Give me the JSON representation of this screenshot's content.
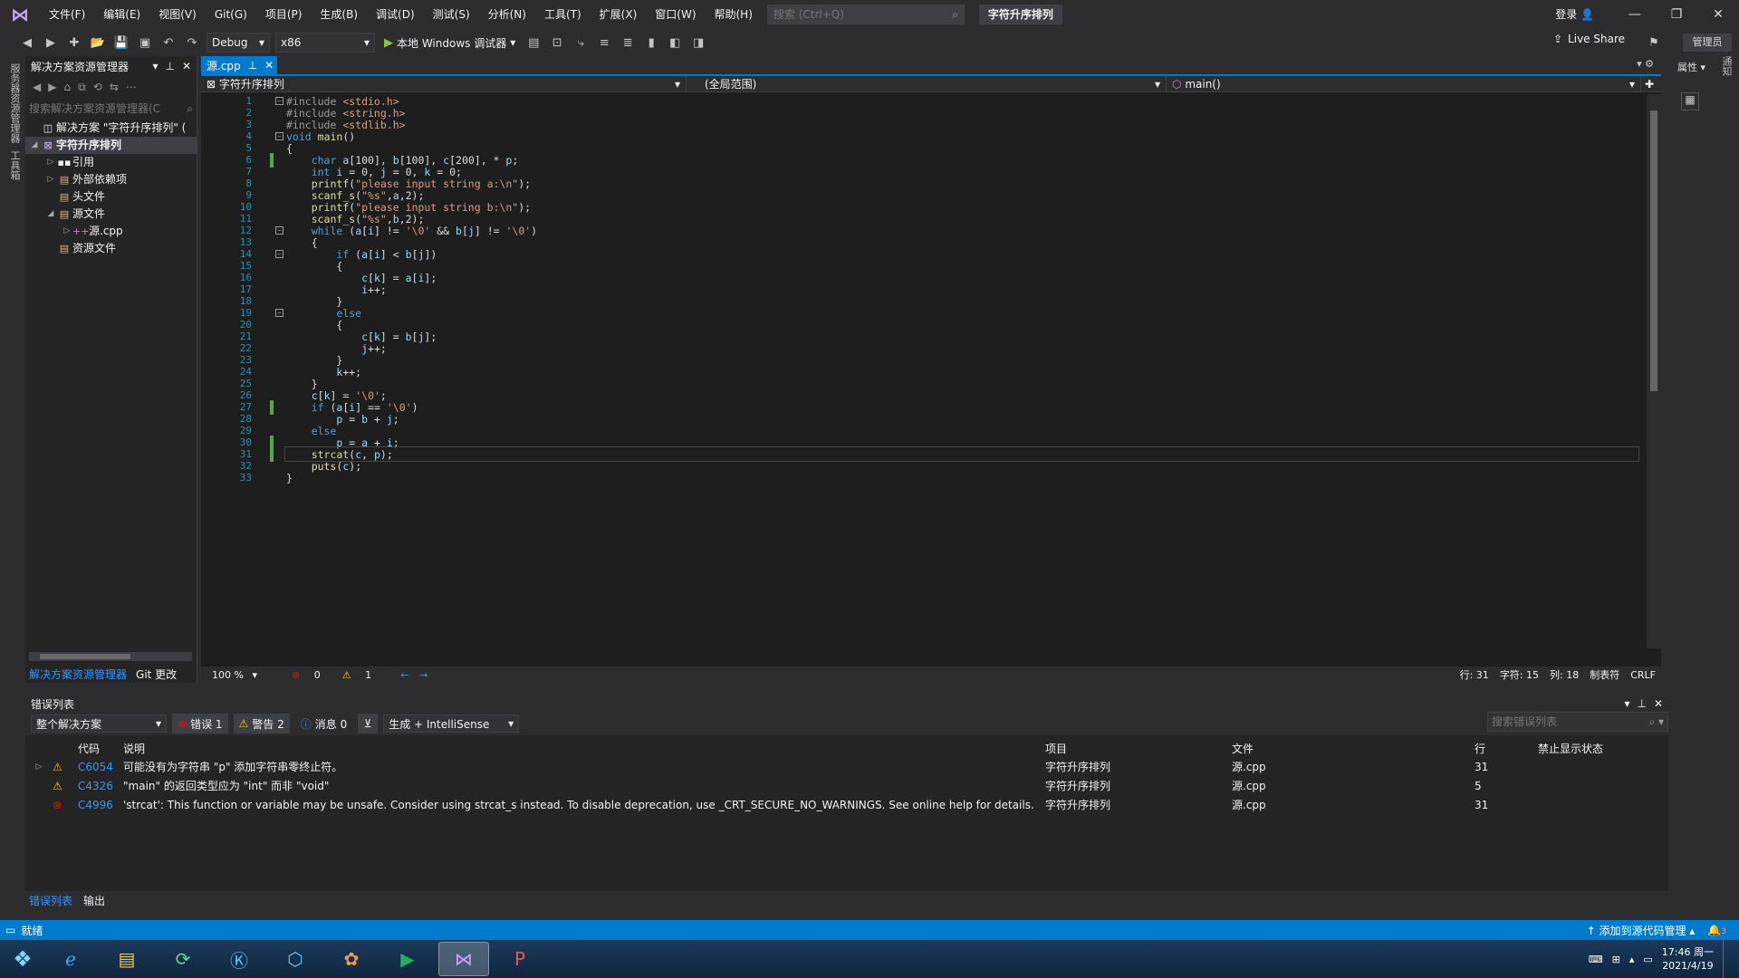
{
  "menubar": {
    "items": [
      "文件(F)",
      "编辑(E)",
      "视图(V)",
      "Git(G)",
      "项目(P)",
      "生成(B)",
      "调试(D)",
      "测试(S)",
      "分析(N)",
      "工具(T)",
      "扩展(X)",
      "窗口(W)",
      "帮助(H)"
    ],
    "search_placeholder": "搜索 (Ctrl+Q)",
    "solution_title": "字符升序排列",
    "login": "登录"
  },
  "toolbar": {
    "config": "Debug",
    "platform": "x86",
    "run_label": "本地 Windows 调试器",
    "liveshare": "Live Share",
    "admin": "管理员"
  },
  "left_strip": {
    "tabs": [
      "服务器资源管理器",
      "工具箱"
    ]
  },
  "solution_explorer": {
    "title": "解决方案资源管理器",
    "search_placeholder": "搜索解决方案资源管理器(C",
    "tree": [
      {
        "label": "解决方案 \"字符升序排列\" (",
        "icon": "solution-icon"
      },
      {
        "label": "字符升序排列",
        "icon": "project-icon"
      },
      {
        "label": "引用",
        "icon": "references-icon"
      },
      {
        "label": "外部依赖项",
        "icon": "external-deps-icon"
      },
      {
        "label": "头文件",
        "icon": "folder-icon"
      },
      {
        "label": "源文件",
        "icon": "folder-icon"
      },
      {
        "label": "源.cpp",
        "icon": "cpp-file-icon"
      },
      {
        "label": "资源文件",
        "icon": "folder-icon"
      }
    ],
    "bottom_tabs": [
      "解决方案资源管理器",
      "Git 更改"
    ]
  },
  "editor": {
    "tab": "源.cpp",
    "nav": {
      "project": "字符升序排列",
      "scope": "(全局范围)",
      "member": "main()"
    },
    "lines": [
      "#include <stdio.h>",
      "#include <string.h>",
      "#include <stdlib.h>",
      "void main()",
      "{",
      "    char a[100], b[100], c[200], * p;",
      "    int i = 0, j = 0, k = 0;",
      "    printf(\"please input string a:\\n\");",
      "    scanf_s(\"%s\",a,2);",
      "    printf(\"please input string b:\\n\");",
      "    scanf_s(\"%s\",b,2);",
      "    while (a[i] != '\\0' && b[j] != '\\0')",
      "    {",
      "        if (a[i] < b[j])",
      "        {",
      "            c[k] = a[i];",
      "            i++;",
      "        }",
      "        else",
      "        {",
      "            c[k] = b[j];",
      "            j++;",
      "        }",
      "        k++;",
      "    }",
      "    c[k] = '\\0';",
      "    if (a[i] == '\\0')",
      "        p = b + j;",
      "    else",
      "        p = a + i;",
      "    strcat(c, p);",
      "    puts(c);",
      "}"
    ],
    "status": {
      "zoom": "100 %",
      "errors": "0",
      "warnings": "1",
      "line": "行: 31",
      "char": "字符: 15",
      "col": "列: 18",
      "tabs": "制表符",
      "eol": "CRLF"
    }
  },
  "right_strip": {
    "tabs": [
      "属性",
      "通知"
    ]
  },
  "error_list": {
    "title": "错误列表",
    "scope": "整个解决方案",
    "errors_btn": "错误 1",
    "warnings_btn": "警告 2",
    "messages_btn": "消息 0",
    "build_filter": "生成 + IntelliSense",
    "search_placeholder": "搜索错误列表",
    "columns": [
      "代码",
      "说明",
      "项目",
      "文件",
      "行",
      "禁止显示状态"
    ],
    "rows": [
      {
        "severity": "warning",
        "code": "C6054",
        "desc": "可能没有为字符串 \"p\" 添加字符串零终止符。",
        "project": "字符升序排列",
        "file": "源.cpp",
        "line": "31"
      },
      {
        "severity": "warning",
        "code": "C4326",
        "desc": "\"main\" 的返回类型应为 \"int\" 而非 \"void\"",
        "project": "字符升序排列",
        "file": "源.cpp",
        "line": "5"
      },
      {
        "severity": "error",
        "code": "C4996",
        "desc": "'strcat': This function or variable may be unsafe. Consider using strcat_s instead. To disable deprecation, use _CRT_SECURE_NO_WARNINGS. See online help for details.",
        "project": "字符升序排列",
        "file": "源.cpp",
        "line": "31"
      }
    ],
    "bottom_tabs": [
      "错误列表",
      "输出"
    ]
  },
  "statusbar": {
    "state": "就绪",
    "source_control": "添加到源代码管理",
    "notifications": "3"
  },
  "taskbar": {
    "time": "17:46 周一",
    "date": "2021/4/19"
  }
}
